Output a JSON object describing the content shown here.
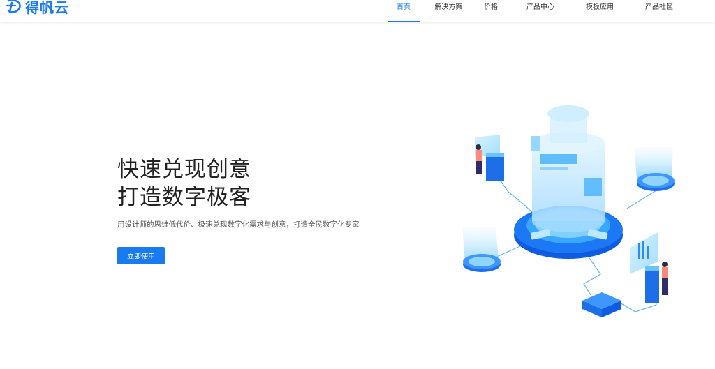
{
  "brand": {
    "name": "得帆云"
  },
  "nav": {
    "items": [
      {
        "label": "首页",
        "active": true
      },
      {
        "label": "解决方案",
        "active": false
      },
      {
        "label": "价格",
        "active": false
      },
      {
        "label": "产品中心",
        "active": false
      },
      {
        "label": "模板应用",
        "active": false
      },
      {
        "label": "产品社区",
        "active": false
      }
    ]
  },
  "hero": {
    "title_line1": "快速兑现创意",
    "title_line2": "打造数字极客",
    "subtitle": "用设计师的思维低代价、极速兑现数字化需求与创意，打造全民数字化专家",
    "cta_label": "立即使用"
  },
  "colors": {
    "accent": "#1a7af0",
    "text_dark": "#222222",
    "text_muted": "#555555"
  }
}
